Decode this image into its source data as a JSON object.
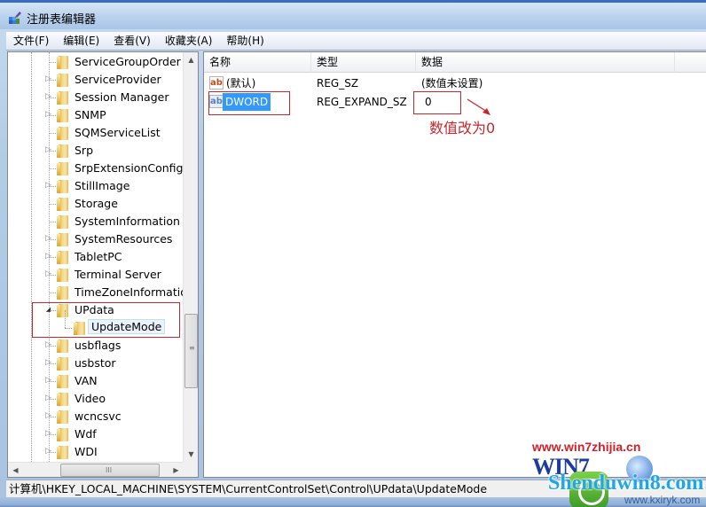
{
  "window": {
    "title": "注册表编辑器",
    "app_icon": "registry-editor-icon"
  },
  "menu": [
    {
      "label": "文件(F)"
    },
    {
      "label": "编辑(E)"
    },
    {
      "label": "查看(V)"
    },
    {
      "label": "收藏夹(A)"
    },
    {
      "label": "帮助(H)"
    }
  ],
  "tree": {
    "items": [
      {
        "label": "ServiceGroupOrder",
        "expandable": false
      },
      {
        "label": "ServiceProvider",
        "expandable": true
      },
      {
        "label": "Session Manager",
        "expandable": true
      },
      {
        "label": "SNMP",
        "expandable": true
      },
      {
        "label": "SQMServiceList",
        "expandable": false
      },
      {
        "label": "Srp",
        "expandable": true
      },
      {
        "label": "SrpExtensionConfig",
        "expandable": false
      },
      {
        "label": "StillImage",
        "expandable": true
      },
      {
        "label": "Storage",
        "expandable": false
      },
      {
        "label": "SystemInformation",
        "expandable": false
      },
      {
        "label": "SystemResources",
        "expandable": true
      },
      {
        "label": "TabletPC",
        "expandable": true
      },
      {
        "label": "Terminal Server",
        "expandable": true
      },
      {
        "label": "TimeZoneInformation",
        "expandable": false
      },
      {
        "label": "UPdata",
        "expandable": true,
        "expanded": true
      },
      {
        "label": "UpdateMode",
        "child": true,
        "selected": true
      },
      {
        "label": "usbflags",
        "expandable": true
      },
      {
        "label": "usbstor",
        "expandable": true
      },
      {
        "label": "VAN",
        "expandable": true
      },
      {
        "label": "Video",
        "expandable": true
      },
      {
        "label": "wcncsvc",
        "expandable": true
      },
      {
        "label": "Wdf",
        "expandable": true
      },
      {
        "label": "WDI",
        "expandable": true
      }
    ],
    "scrollbar_grip": "≡",
    "hscroll_grip": "III"
  },
  "list": {
    "columns": [
      "名称",
      "类型",
      "数据"
    ],
    "rows": [
      {
        "icon": "string-value-icon",
        "name": "(默认)",
        "type": "REG_SZ",
        "data": "(数值未设置)"
      },
      {
        "icon": "binary-value-icon",
        "name": "DWORD",
        "type": "REG_EXPAND_SZ",
        "data": "0",
        "selected": true
      }
    ]
  },
  "annotation": {
    "text": "数值改为0",
    "color": "#c8272d"
  },
  "statusbar": {
    "path": "计算机\\HKEY_LOCAL_MACHINE\\SYSTEM\\CurrentControlSet\\Control\\UPdata\\UpdateMode"
  },
  "watermark": {
    "url": "www.win7zhijia.cn",
    "brand": "WIN7",
    "site": "Shenduwin8.com",
    "small_url": "www.kxiryk.com"
  }
}
